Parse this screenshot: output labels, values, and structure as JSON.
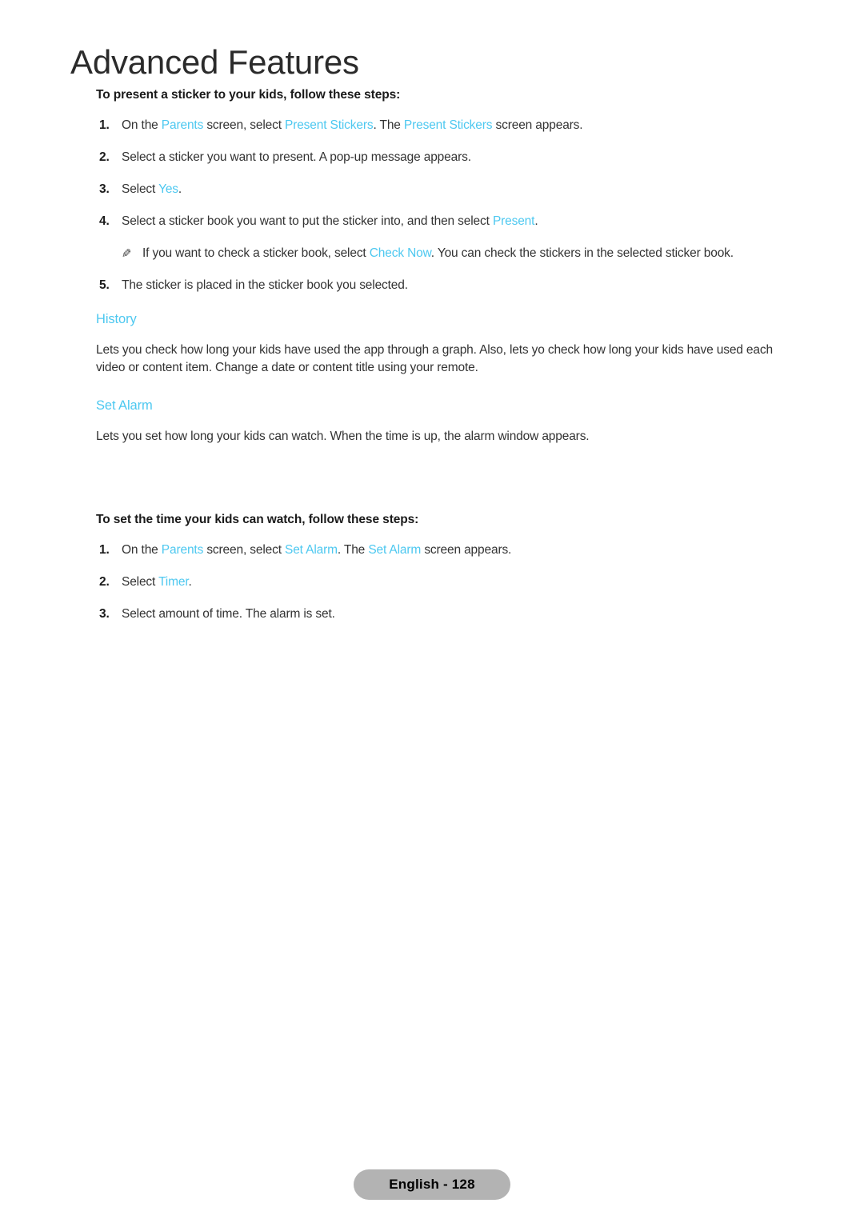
{
  "document": {
    "chapter_title": "Advanced Features",
    "footer_label": "English - 128"
  },
  "colors": {
    "term_accent": "#4dc8f0",
    "body_text": "#333333",
    "heading_text": "#1a1a1a",
    "title_text": "#2b2b2b",
    "footer_pill_bg": "#b3b3b3"
  },
  "icons": {
    "note": "✎"
  },
  "procedure_stickers": {
    "heading": "To present a sticker to your kids, follow these steps:",
    "steps": [
      {
        "number": "1.",
        "parts": [
          {
            "text": "On the ",
            "term": false
          },
          {
            "text": "Parents",
            "term": true
          },
          {
            "text": " screen, select ",
            "term": false
          },
          {
            "text": "Present Stickers",
            "term": true
          },
          {
            "text": ". The ",
            "term": false
          },
          {
            "text": "Present Stickers",
            "term": true
          },
          {
            "text": " screen appears.",
            "term": false
          }
        ]
      },
      {
        "number": "2.",
        "parts": [
          {
            "text": "Select a sticker you want to present. A pop-up message appears.",
            "term": false
          }
        ]
      },
      {
        "number": "3.",
        "parts": [
          {
            "text": "Select ",
            "term": false
          },
          {
            "text": "Yes",
            "term": true
          },
          {
            "text": ".",
            "term": false
          }
        ]
      },
      {
        "number": "4.",
        "parts": [
          {
            "text": "Select a sticker book you want to put the sticker into, and then select ",
            "term": false
          },
          {
            "text": "Present",
            "term": true
          },
          {
            "text": ".",
            "term": false
          }
        ]
      },
      {
        "number": "5.",
        "parts": [
          {
            "text": "The sticker is placed in the sticker book you selected.",
            "term": false
          }
        ]
      }
    ],
    "note": {
      "parts": [
        {
          "text": "If you want to check a sticker book, select ",
          "term": false
        },
        {
          "text": "Check Now",
          "term": true
        },
        {
          "text": ". You can check the stickers in the selected sticker book.",
          "term": false
        }
      ]
    }
  },
  "section_history": {
    "heading": "History",
    "body": "Lets you check how long your kids have used the app through a graph. Also, lets yo check how long your kids have used each video or content item. Change a date or content title using your remote."
  },
  "section_set_alarm": {
    "heading": "Set Alarm",
    "body": "Lets you set how long your kids can watch. When the time is up, the alarm window appears."
  },
  "procedure_alarm": {
    "heading": "To set the time your kids can watch, follow these steps:",
    "steps": [
      {
        "number": "1.",
        "parts": [
          {
            "text": "On the ",
            "term": false
          },
          {
            "text": "Parents",
            "term": true
          },
          {
            "text": " screen, select ",
            "term": false
          },
          {
            "text": "Set Alarm",
            "term": true
          },
          {
            "text": ". The ",
            "term": false
          },
          {
            "text": "Set Alarm",
            "term": true
          },
          {
            "text": " screen appears.",
            "term": false
          }
        ]
      },
      {
        "number": "2.",
        "parts": [
          {
            "text": "Select ",
            "term": false
          },
          {
            "text": "Timer",
            "term": true
          },
          {
            "text": ".",
            "term": false
          }
        ]
      },
      {
        "number": "3.",
        "parts": [
          {
            "text": "Select amount of time. The alarm is set.",
            "term": false
          }
        ]
      }
    ]
  }
}
